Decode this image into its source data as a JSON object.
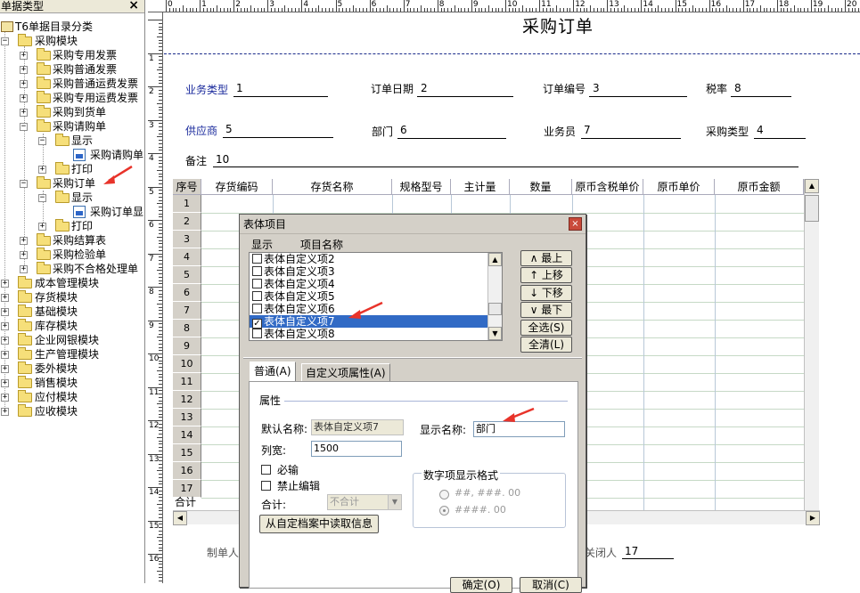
{
  "left_panel": {
    "title": "单据类型",
    "close_glyph": "×",
    "root": "T6单据目录分类",
    "items": [
      "采购模块",
      "采购专用发票",
      "采购普通发票",
      "采购普通运费发票",
      "采购专用运费发票",
      "采购到货单",
      "采购请购单",
      "显示",
      "采购请购单",
      "打印",
      "采购订单",
      "显示",
      "采购订单显",
      "打印",
      "采购结算表",
      "采购检验单",
      "采购不合格处理单",
      "成本管理模块",
      "存货模块",
      "基础模块",
      "库存模块",
      "企业网银模块",
      "生产管理模块",
      "委外模块",
      "销售模块",
      "应付模块",
      "应收模块"
    ]
  },
  "ruler_top": [
    "0",
    "1",
    "2",
    "3",
    "4",
    "5",
    "6",
    "7",
    "8",
    "9",
    "10",
    "11",
    "12",
    "13",
    "14",
    "15",
    "16",
    "17",
    "18",
    "19",
    "20"
  ],
  "ruler_left": [
    "1",
    "2",
    "3",
    "4",
    "5",
    "6",
    "7",
    "8",
    "9",
    "10",
    "11",
    "12",
    "13",
    "14",
    "15",
    "16"
  ],
  "document": {
    "title": "采购订单",
    "header_fields": {
      "biz_type": {
        "label": "业务类型",
        "value": "1"
      },
      "order_date": {
        "label": "订单日期",
        "value": "2"
      },
      "order_no": {
        "label": "订单编号",
        "value": "3"
      },
      "tax_rate": {
        "label": "税率",
        "value": "8"
      },
      "supplier": {
        "label": "供应商",
        "value": "5"
      },
      "dept": {
        "label": "部门",
        "value": "6"
      },
      "clerk": {
        "label": "业务员",
        "value": "7"
      },
      "purchase_type": {
        "label": "采购类型",
        "value": "4"
      },
      "remark": {
        "label": "备注",
        "value": "10"
      }
    },
    "columns": [
      "序号",
      "存货编码",
      "存货名称",
      "规格型号",
      "主计量",
      "数量",
      "原币含税单价",
      "原币单价",
      "原币金额"
    ],
    "row_numbers": [
      "1",
      "2",
      "3",
      "4",
      "5",
      "6",
      "7",
      "8",
      "9",
      "10",
      "11",
      "12",
      "13",
      "14",
      "15",
      "16",
      "17"
    ],
    "total_label": "合计",
    "footer": {
      "maker": "制单人",
      "closer": "关闭人",
      "closer_value": "17"
    },
    "accent_color": "#1a2a9c"
  },
  "dialog": {
    "title": "表体项目",
    "close_glyph": "×",
    "list_headers": {
      "show": "显示",
      "name": "项目名称"
    },
    "list_items": [
      {
        "label": "表体自定义项2",
        "checked": false
      },
      {
        "label": "表体自定义项3",
        "checked": false
      },
      {
        "label": "表体自定义项4",
        "checked": false
      },
      {
        "label": "表体自定义项5",
        "checked": false
      },
      {
        "label": "表体自定义项6",
        "checked": false
      },
      {
        "label": "表体自定义项7",
        "checked": true,
        "selected": true
      },
      {
        "label": "表体自定义项8",
        "checked": false
      }
    ],
    "check_glyph": "✓",
    "buttons": {
      "top": "∧ 最上",
      "up": "↑ 上移",
      "down": "↓ 下移",
      "bottom": "∨ 最下",
      "select_all": "全选(S)",
      "clear_all": "全清(L)"
    },
    "tabs": [
      "普通(A)",
      "自定义项属性(A)"
    ],
    "properties": {
      "section": "属性",
      "default_name_label": "默认名称:",
      "default_name_value": "表体自定义项7",
      "display_name_label": "显示名称:",
      "display_name_value": "部门",
      "col_width_label": "列宽:",
      "col_width_value": "1500",
      "required_label": "必输",
      "no_edit_label": "禁止编辑",
      "total_label": "合计:",
      "total_value": "不合计",
      "num_format_title": "数字项显示格式",
      "format_1": "##, ###. 00",
      "format_2": "####. 00",
      "read_button": "从自定档案中读取信息"
    },
    "footer_buttons": {
      "ok": "确定(O)",
      "cancel": "取消(C)"
    }
  },
  "annotation_color": "#e8332a"
}
